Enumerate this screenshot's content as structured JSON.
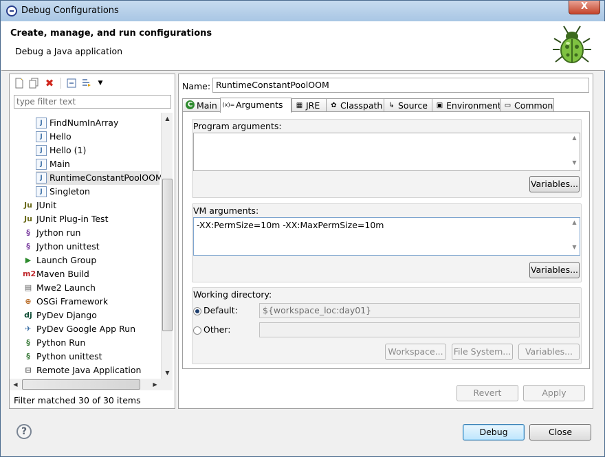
{
  "window": {
    "title": "Debug Configurations",
    "close_glyph": "X"
  },
  "header": {
    "title": "Create, manage, and run configurations",
    "subtitle": "Debug a Java application"
  },
  "left": {
    "filter_placeholder": "type filter text",
    "tree": [
      {
        "label": "FindNumInArray",
        "icon": "java-app-icon",
        "glyph": "J",
        "indent": 1,
        "color": "#3a6ea5"
      },
      {
        "label": "Hello",
        "icon": "java-app-icon",
        "glyph": "J",
        "indent": 1,
        "color": "#3a6ea5"
      },
      {
        "label": "Hello (1)",
        "icon": "java-app-icon",
        "glyph": "J",
        "indent": 1,
        "color": "#3a6ea5"
      },
      {
        "label": "Main",
        "icon": "java-app-icon",
        "glyph": "J",
        "indent": 1,
        "color": "#3a6ea5"
      },
      {
        "label": "RuntimeConstantPoolOOM",
        "icon": "java-app-icon",
        "glyph": "J",
        "indent": 1,
        "color": "#3a6ea5",
        "selected": true
      },
      {
        "label": "Singleton",
        "icon": "java-app-icon",
        "glyph": "J",
        "indent": 1,
        "color": "#3a6ea5"
      },
      {
        "label": "JUnit",
        "icon": "junit-icon",
        "glyph": "Ju",
        "indent": 0,
        "color": "#6b6b1a"
      },
      {
        "label": "JUnit Plug-in Test",
        "icon": "junit-plugin-icon",
        "glyph": "Ju",
        "indent": 0,
        "color": "#6b6b1a"
      },
      {
        "label": "Jython run",
        "icon": "jython-run-icon",
        "glyph": "§",
        "indent": 0,
        "color": "#7b3fa0"
      },
      {
        "label": "Jython unittest",
        "icon": "jython-unittest-icon",
        "glyph": "§",
        "indent": 0,
        "color": "#7b3fa0"
      },
      {
        "label": "Launch Group",
        "icon": "launch-group-icon",
        "glyph": "▶",
        "indent": 0,
        "color": "#2e8b2e"
      },
      {
        "label": "Maven Build",
        "icon": "maven-icon",
        "glyph": "m2",
        "indent": 0,
        "color": "#c0282d"
      },
      {
        "label": "Mwe2 Launch",
        "icon": "mwe2-icon",
        "glyph": "▤",
        "indent": 0,
        "color": "#666666"
      },
      {
        "label": "OSGi Framework",
        "icon": "osgi-icon",
        "glyph": "⊕",
        "indent": 0,
        "color": "#b5651d"
      },
      {
        "label": "PyDev Django",
        "icon": "django-icon",
        "glyph": "dj",
        "indent": 0,
        "color": "#0c4b33"
      },
      {
        "label": "PyDev Google App Run",
        "icon": "google-app-icon",
        "glyph": "✈",
        "indent": 0,
        "color": "#3a6ea5"
      },
      {
        "label": "Python Run",
        "icon": "python-run-icon",
        "glyph": "§",
        "indent": 0,
        "color": "#3a7a3a"
      },
      {
        "label": "Python unittest",
        "icon": "python-unittest-icon",
        "glyph": "§",
        "indent": 0,
        "color": "#3a7a3a"
      },
      {
        "label": "Remote Java Application",
        "icon": "remote-java-icon",
        "glyph": "⊟",
        "indent": 0,
        "color": "#555555"
      }
    ],
    "status": "Filter matched 30 of 30 items",
    "scroll_position": 0.6
  },
  "right": {
    "name_label": "Name:",
    "name_value": "RuntimeConstantPoolOOM",
    "tabs": [
      {
        "label": "Main",
        "icon": "main-tab-icon",
        "glyph": "C"
      },
      {
        "label": "Arguments",
        "icon": "arguments-tab-icon",
        "glyph": "(x)=",
        "active": true
      },
      {
        "label": "JRE",
        "icon": "jre-tab-icon",
        "glyph": "▦"
      },
      {
        "label": "Classpath",
        "icon": "classpath-tab-icon",
        "glyph": "✿"
      },
      {
        "label": "Source",
        "icon": "source-tab-icon",
        "glyph": "↳"
      },
      {
        "label": "Environment",
        "icon": "environment-tab-icon",
        "glyph": "▣"
      },
      {
        "label": "Common",
        "icon": "common-tab-icon",
        "glyph": "▭"
      }
    ],
    "program_args": {
      "label": "Program arguments:",
      "value": "",
      "variables_btn": "Variables..."
    },
    "vm_args": {
      "label": "VM arguments:",
      "value": "-XX:PermSize=10m -XX:MaxPermSize=10m",
      "variables_btn": "Variables..."
    },
    "working_dir": {
      "label": "Working directory:",
      "default_label": "Default:",
      "default_value": "${workspace_loc:day01}",
      "other_label": "Other:",
      "other_value": "",
      "workspace_btn": "Workspace...",
      "filesystem_btn": "File System...",
      "variables_btn": "Variables..."
    },
    "revert_btn": "Revert",
    "apply_btn": "Apply"
  },
  "footer": {
    "help_glyph": "?",
    "debug_btn": "Debug",
    "close_btn": "Close"
  }
}
